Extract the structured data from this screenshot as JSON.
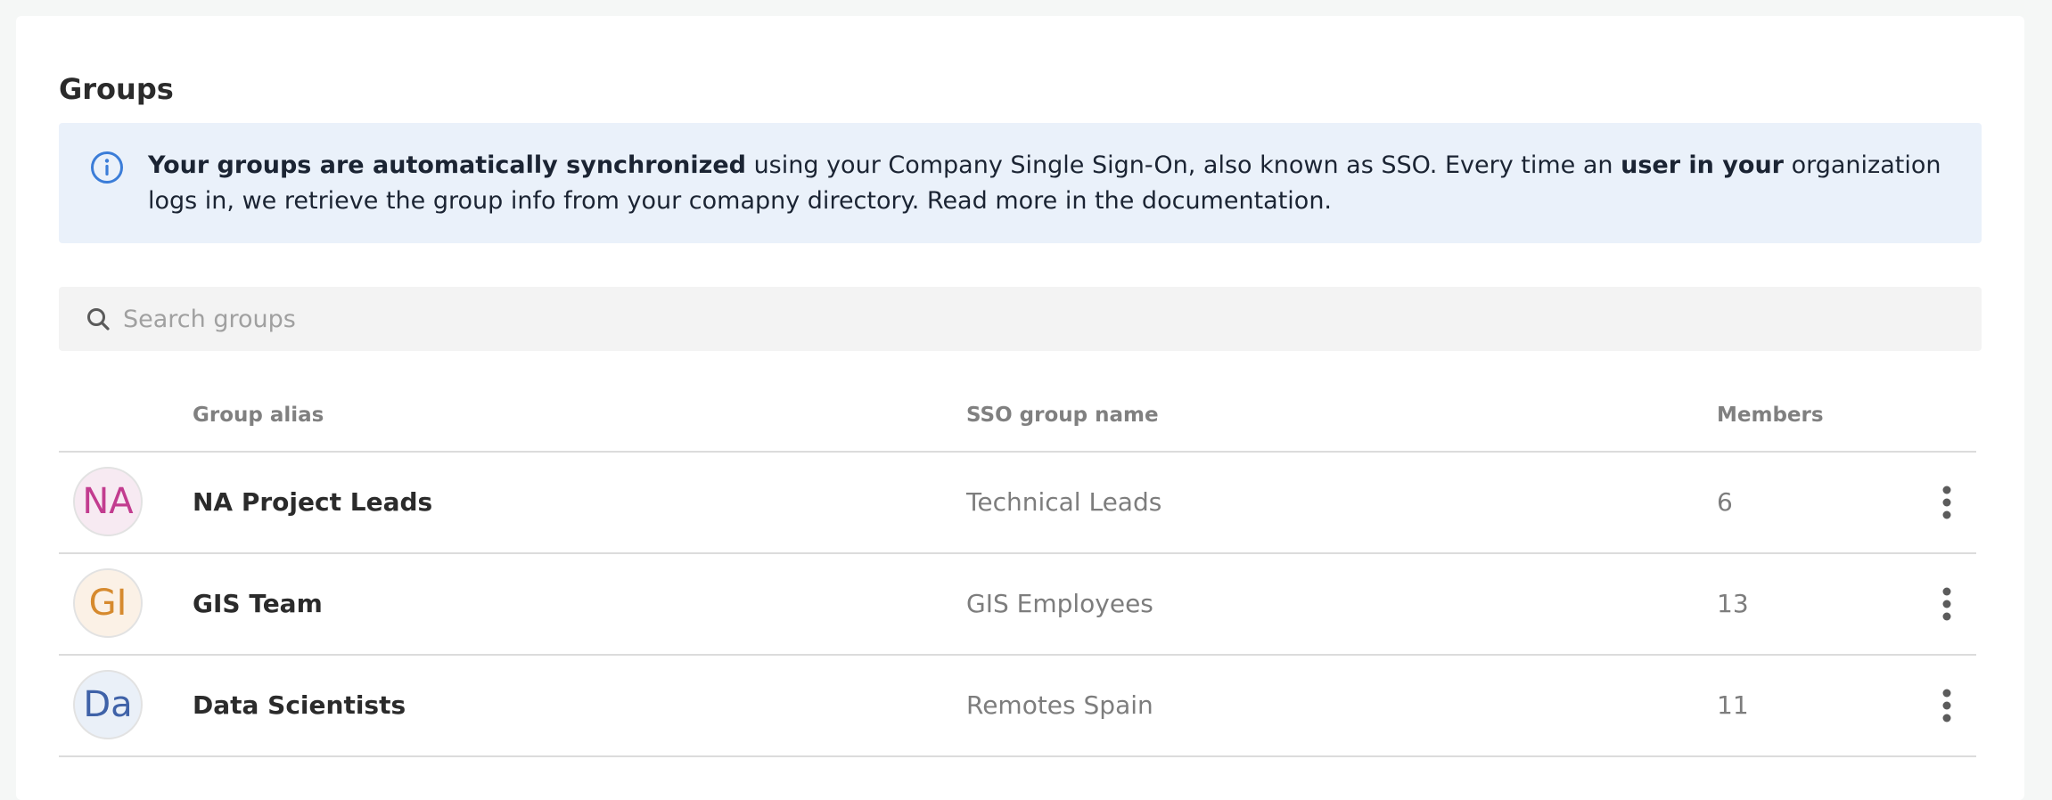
{
  "page": {
    "title": "Groups"
  },
  "info": {
    "bold1": "Your groups are automatically synchronized",
    "text1": " using your Company Single Sign-On, also known as SSO. Every time an ",
    "bold2": "user in your",
    "text2": " organization logs in, we retrieve the group info from your comapny directory. Read more in the documentation.",
    "icon": "info-icon",
    "accent": "#3b7dd8"
  },
  "search": {
    "placeholder": "Search groups",
    "value": "",
    "icon": "search-icon"
  },
  "table": {
    "headers": {
      "alias": "Group alias",
      "sso": "SSO group name",
      "members": "Members"
    },
    "rows": [
      {
        "initials": "NA",
        "alias": "NA Project Leads",
        "sso": "Technical Leads",
        "members": "6",
        "avatar_bg": "#f7eaf2",
        "avatar_color": "#c23c8f"
      },
      {
        "initials": "GI",
        "alias": "GIS Team",
        "sso": "GIS Employees",
        "members": "13",
        "avatar_bg": "#fbf1e6",
        "avatar_color": "#d68a2e"
      },
      {
        "initials": "Da",
        "alias": "Data Scientists",
        "sso": "Remotes Spain",
        "members": "11",
        "avatar_bg": "#eaf0f8",
        "avatar_color": "#3f62a8"
      }
    ]
  }
}
